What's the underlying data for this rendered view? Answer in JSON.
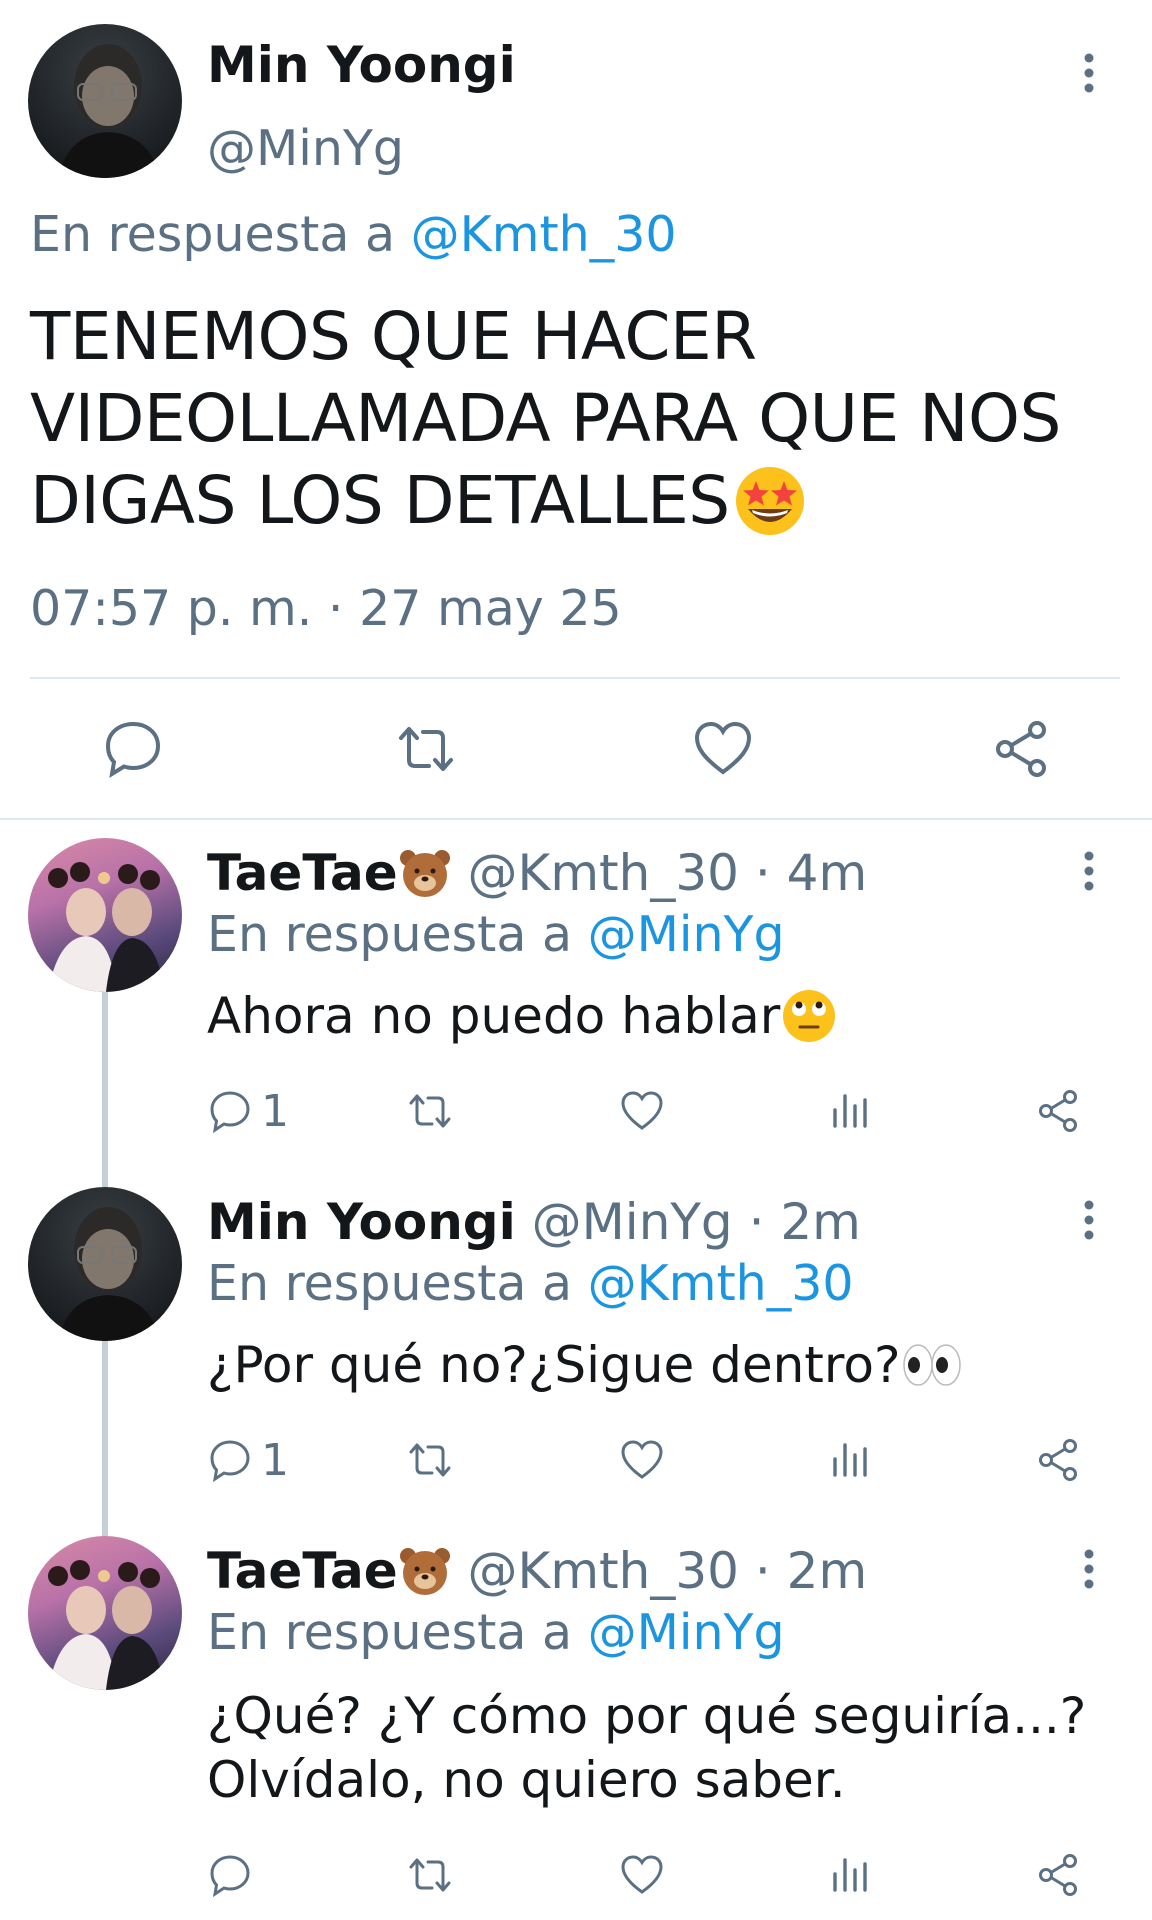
{
  "colors": {
    "text": "#14171a",
    "secondary": "#5b7083",
    "link": "#1b95e0",
    "divider": "#e1e8ed",
    "thread_line": "#c4cfd6"
  },
  "main_tweet": {
    "name": "Min Yoongi",
    "handle": "@MinYg",
    "reply_prefix": "En respuesta a",
    "reply_to": "@Kmth_30",
    "text_lines": [
      "TENEMOS QUE HACER",
      "VIDEOLLAMADA PARA QUE NOS",
      "DIGAS LOS DETALLES"
    ],
    "emoji": "star-struck-emoji",
    "timestamp": "07:57 p. m. · 27 may 25",
    "actions": [
      "reply-icon",
      "retweet-icon",
      "like-icon",
      "share-icon"
    ]
  },
  "replies": [
    {
      "name": "TaeTae",
      "name_emoji": "bear-face-emoji",
      "handle": "@Kmth_30",
      "time": "· 4m",
      "reply_prefix": "En respuesta a",
      "reply_to": "@MinYg",
      "text": "Ahora no puedo hablar",
      "text_emoji": "eye-roll-emoji",
      "reply_count": "1"
    },
    {
      "name": "Min Yoongi",
      "handle": "@MinYg",
      "time": "· 2m",
      "reply_prefix": "En respuesta a",
      "reply_to": "@Kmth_30",
      "text": "¿Por qué no?¿Sigue dentro?",
      "text_emoji": "eyes-emoji",
      "reply_count": "1"
    },
    {
      "name": "TaeTae",
      "name_emoji": "bear-face-emoji",
      "handle": "@Kmth_30",
      "time": "· 2m",
      "reply_prefix": "En respuesta a",
      "reply_to": "@MinYg",
      "text_lines": [
        "¿Qué? ¿Y cómo por qué seguiría...?",
        "Olvídalo, no quiero saber."
      ],
      "reply_count": ""
    }
  ]
}
